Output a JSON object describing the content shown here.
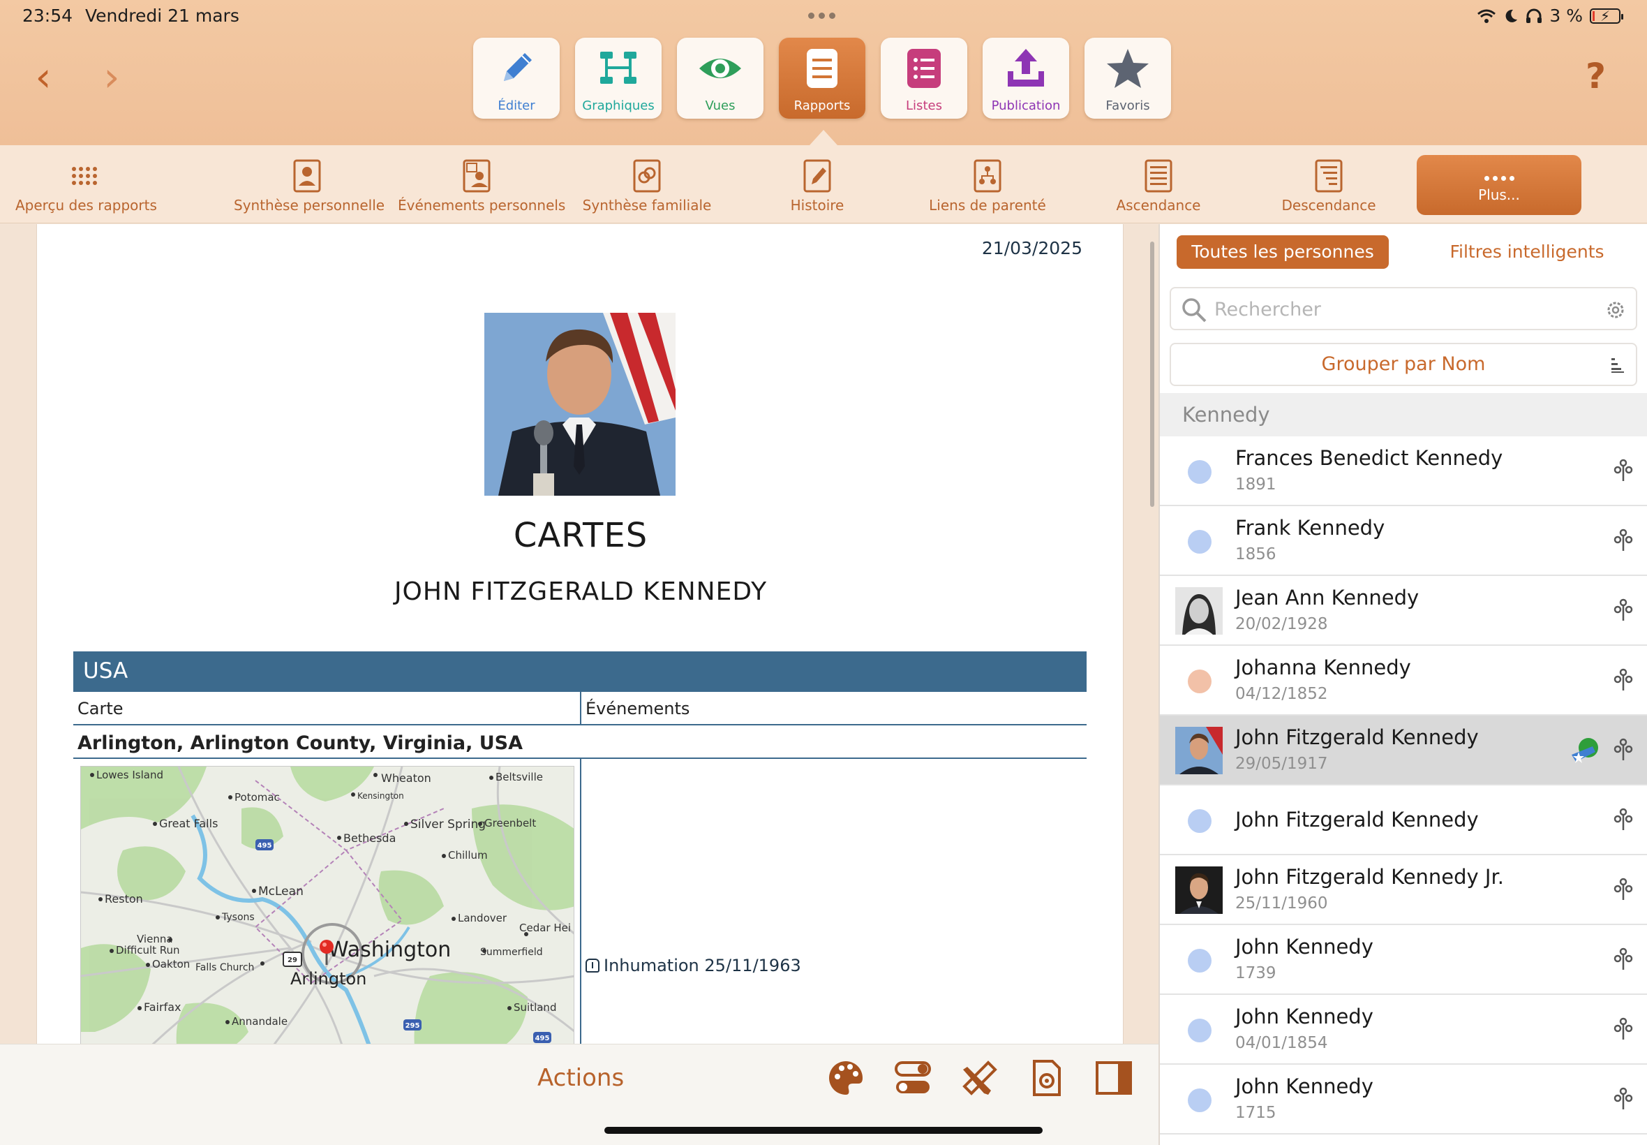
{
  "status": {
    "time": "23:54",
    "date": "Vendredi 21 mars",
    "battery": "3 %"
  },
  "toolbar": {
    "tools": [
      {
        "label": "Éditer",
        "icon": "pencil-icon",
        "color": "#3f7fd1"
      },
      {
        "label": "Graphiques",
        "icon": "chart-icon",
        "color": "#1fa89b"
      },
      {
        "label": "Vues",
        "icon": "eye-icon",
        "color": "#2e9e5a"
      },
      {
        "label": "Rapports",
        "icon": "report-icon",
        "color": "#ffffff"
      },
      {
        "label": "Listes",
        "icon": "list-icon",
        "color": "#c63d7c"
      },
      {
        "label": "Publication",
        "icon": "upload-icon",
        "color": "#8e35b4"
      },
      {
        "label": "Favoris",
        "icon": "star-icon",
        "color": "#5d6472"
      }
    ],
    "help": "?"
  },
  "ribbon": {
    "items": [
      {
        "label": "Aperçu des rapports"
      },
      {
        "label": "Synthèse personnelle"
      },
      {
        "label": "Événements personnels"
      },
      {
        "label": "Synthèse familiale"
      },
      {
        "label": "Histoire"
      },
      {
        "label": "Liens de parenté"
      },
      {
        "label": "Ascendance"
      },
      {
        "label": "Descendance"
      }
    ],
    "more_label": "Plus..."
  },
  "report": {
    "date": "21/03/2025",
    "title": "CARTES",
    "subtitle": "JOHN FITZGERALD KENNEDY",
    "country": "USA",
    "col_map": "Carte",
    "col_events": "Événements",
    "place": "Arlington, Arlington County, Virginia, USA",
    "event": "Inhumation 25/11/1963",
    "map_labels": {
      "lowes_island": "Lowes Island",
      "potomac": "Potomac",
      "wheaton": "Wheaton",
      "kensington": "Kensington",
      "beltsville": "Beltsville",
      "great_falls": "Great Falls",
      "silver_spring": "Silver Spring",
      "greenbelt": "Greenbelt",
      "bethesda": "Bethesda",
      "chillum": "Chillum",
      "reston": "Reston",
      "mclean": "McLean",
      "tysons": "Tysons",
      "landover": "Landover",
      "cedar_heights": "Cedar Hei",
      "vienna": "Vienna",
      "difficult_run": "Difficult Run",
      "oakton": "Oakton",
      "falls_church": "Falls Church",
      "washington": "Washington",
      "summerfield": "Summerfield",
      "arlington": "Arlington",
      "fairfax": "Fairfax",
      "annandale": "Annandale",
      "suitland": "Suitland",
      "shield_495a": "495",
      "shield_29": "29",
      "shield_295": "295",
      "shield_495b": "495"
    }
  },
  "actions": {
    "label": "Actions"
  },
  "sidebar": {
    "tab_all": "Toutes les personnes",
    "tab_smart": "Filtres intelligents",
    "search_placeholder": "Rechercher",
    "group_by": "Grouper par Nom",
    "group": "Kennedy",
    "persons": [
      {
        "name": "Frances Benedict Kennedy",
        "date": "1891",
        "avatar": "dot-blue"
      },
      {
        "name": "Frank Kennedy",
        "date": "1856",
        "avatar": "dot-blue"
      },
      {
        "name": "Jean Ann Kennedy",
        "date": "20/02/1928",
        "avatar": "photo"
      },
      {
        "name": "Johanna Kennedy",
        "date": "04/12/1852",
        "avatar": "dot-pink"
      },
      {
        "name": "John Fitzgerald Kennedy",
        "date": "29/05/1917",
        "avatar": "photo",
        "selected": true
      },
      {
        "name": "John Fitzgerald Kennedy",
        "date": "",
        "avatar": "dot-blue"
      },
      {
        "name": "John Fitzgerald Kennedy Jr.",
        "date": "25/11/1960",
        "avatar": "photo"
      },
      {
        "name": "John Kennedy",
        "date": "1739",
        "avatar": "dot-blue"
      },
      {
        "name": "John Kennedy",
        "date": "04/01/1854",
        "avatar": "dot-blue"
      },
      {
        "name": "John Kennedy",
        "date": "1715",
        "avatar": "dot-blue"
      }
    ]
  }
}
